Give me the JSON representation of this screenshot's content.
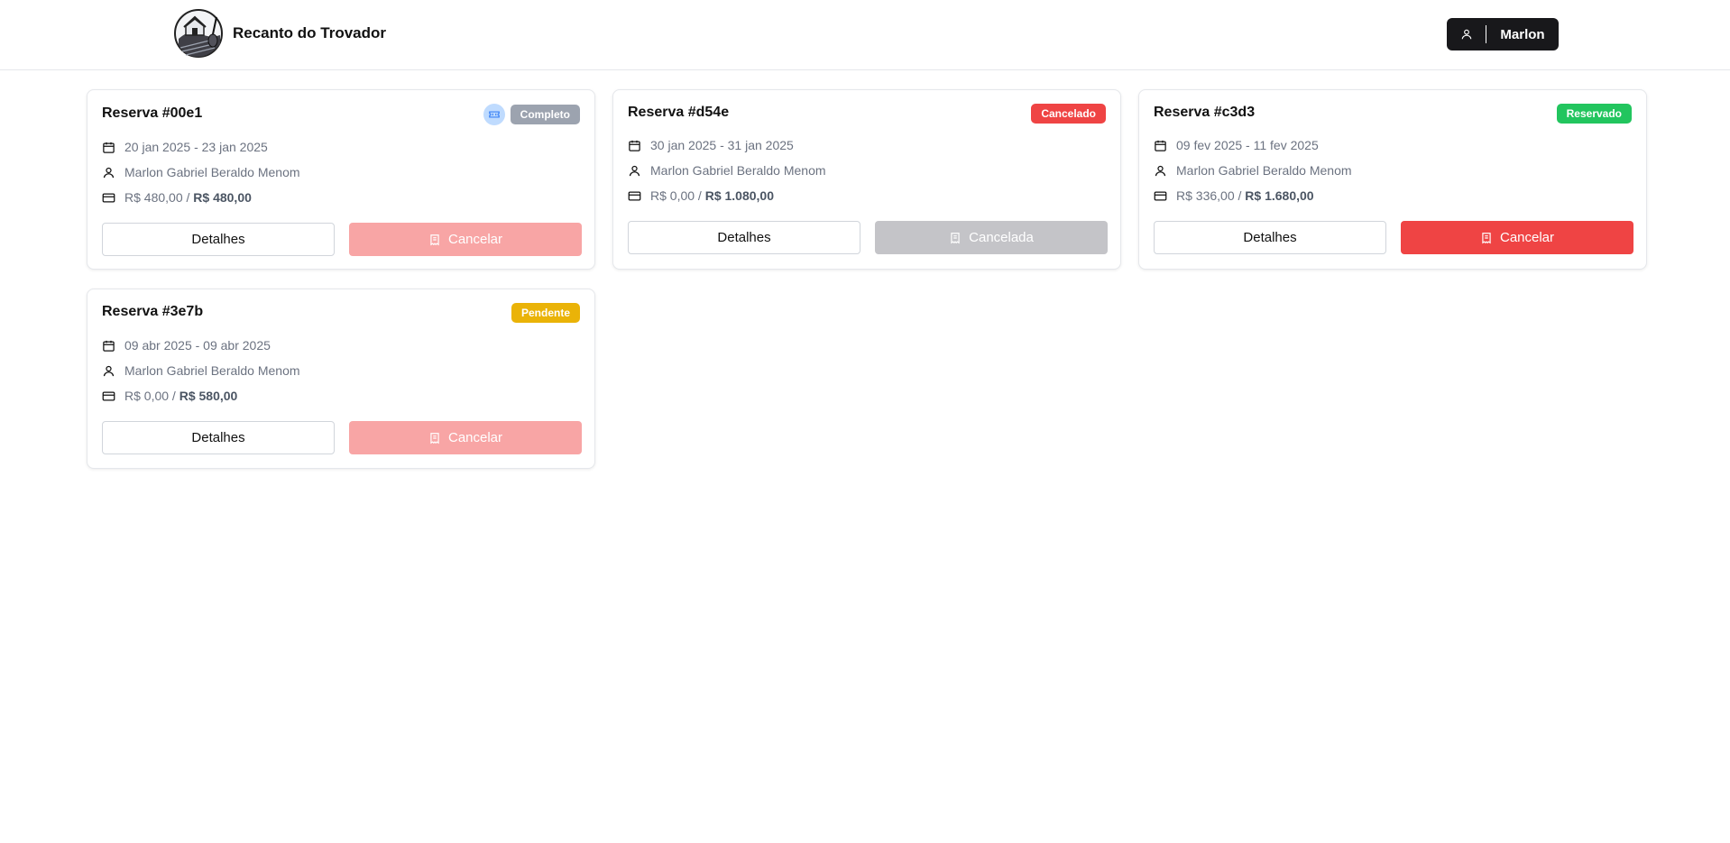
{
  "header": {
    "brand_name": "Recanto do Trovador",
    "user_label": "Marlon"
  },
  "colors": {
    "completo": "#9ca3af",
    "cancelado": "#ef4444",
    "reservado": "#22c55e",
    "pendente": "#eab308",
    "cancel_active": "#ef4444",
    "cancel_disabled": "#f8a5a5",
    "cancelled_disabled": "#c4c4c8"
  },
  "reservations": [
    {
      "title": "Reserva #00e1",
      "status": "Completo",
      "dates": "20 jan 2025 - 23 jan 2025",
      "guest": "Marlon Gabriel Beraldo Menom",
      "paid": "R$ 480,00 /",
      "total": "R$ 480,00",
      "details_label": "Detalhes",
      "cancel_label": "Cancelar"
    },
    {
      "title": "Reserva #d54e",
      "status": "Cancelado",
      "dates": "30 jan 2025 - 31 jan 2025",
      "guest": "Marlon Gabriel Beraldo Menom",
      "paid": "R$ 0,00 /",
      "total": "R$ 1.080,00",
      "details_label": "Detalhes",
      "cancel_label": "Cancelada"
    },
    {
      "title": "Reserva #c3d3",
      "status": "Reservado",
      "dates": "09 fev 2025 - 11 fev 2025",
      "guest": "Marlon Gabriel Beraldo Menom",
      "paid": "R$ 336,00 /",
      "total": "R$ 1.680,00",
      "details_label": "Detalhes",
      "cancel_label": "Cancelar"
    },
    {
      "title": "Reserva #3e7b",
      "status": "Pendente",
      "dates": "09 abr 2025 - 09 abr 2025",
      "guest": "Marlon Gabriel Beraldo Menom",
      "paid": "R$ 0,00 /",
      "total": "R$ 580,00",
      "details_label": "Detalhes",
      "cancel_label": "Cancelar"
    }
  ]
}
